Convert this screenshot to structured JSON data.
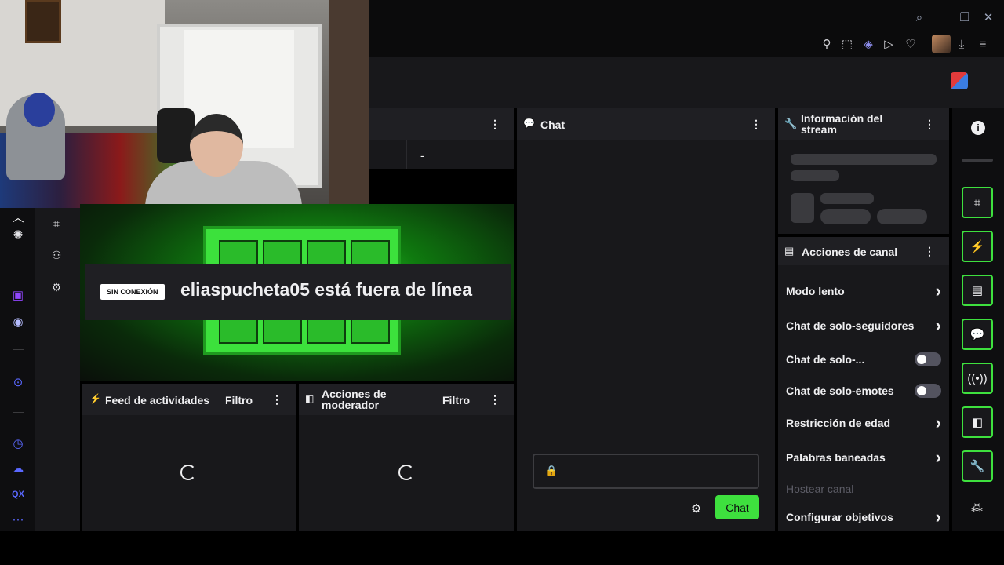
{
  "titlebar": {
    "icons": [
      "search-icon",
      "restore-icon",
      "close-icon"
    ]
  },
  "toolbar": {
    "icons": [
      "pin-icon",
      "screenshot-icon",
      "pocket-icon",
      "play-icon",
      "heart-icon",
      "download-icon",
      "menu-icon"
    ]
  },
  "preview": {
    "offline_badge": "SIN CONEXIÓN",
    "offline_message": "eliaspucheta05 está fuera de línea",
    "top_cell_label": "-"
  },
  "activity_feed": {
    "title": "Feed de actividades",
    "filter": "Filtro"
  },
  "mod_actions": {
    "title": "Acciones de moderador",
    "filter": "Filtro"
  },
  "chat": {
    "title": "Chat",
    "send_label": "Chat"
  },
  "stream_info": {
    "title": "Información del stream"
  },
  "channel_actions": {
    "title": "Acciones de canal",
    "items": [
      {
        "label": "Modo lento",
        "control": "chevron"
      },
      {
        "label": "Chat de solo-seguidores",
        "control": "chevron"
      },
      {
        "label": "Chat de solo-...",
        "control": "toggle",
        "on": false
      },
      {
        "label": "Chat de solo-emotes",
        "control": "toggle",
        "on": false
      },
      {
        "label": "Restricción de edad",
        "control": "chevron"
      },
      {
        "label": "Palabras baneadas",
        "control": "chevron"
      },
      {
        "label": "Hostear canal",
        "control": "none",
        "disabled": true
      },
      {
        "label": "Configurar objetivos",
        "control": "chevron"
      }
    ]
  },
  "left_rail": {
    "bottom_label": "QX"
  },
  "colors": {
    "accent_green": "#3ee03e",
    "bg_panel": "#18181b",
    "bg_dark": "#0e0e10",
    "twitch_purple": "#9146ff"
  }
}
